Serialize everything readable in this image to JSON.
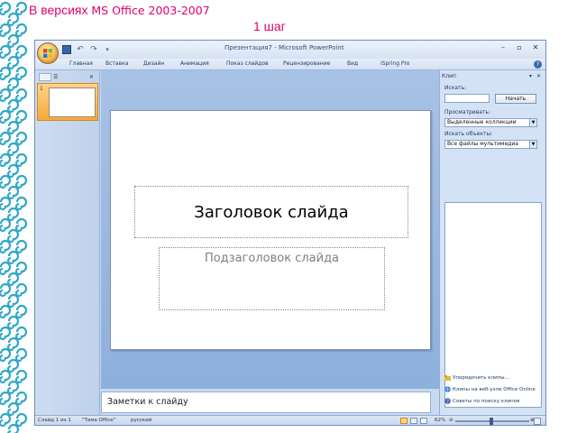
{
  "heading": {
    "prefix": "В версиях ",
    "suffix": "MS Office 2003-2007",
    "step": "1 шаг"
  },
  "colors": {
    "heading": "#e0006c",
    "ornament": "#2fa8c8",
    "ribbon": "#d4e2f4",
    "slide_selected": "#f6a93a"
  },
  "window": {
    "title": "Презентация7 - Microsoft PowerPoint",
    "controls": [
      "minimize-icon",
      "maximize-icon",
      "close-icon"
    ]
  },
  "quick_access": [
    "save-icon",
    "undo-icon",
    "redo-icon",
    "more-icon"
  ],
  "ribbon": {
    "tabs": [
      "Главная",
      "Вставка",
      "Дизайн",
      "Анимация",
      "Показ слайдов",
      "Рецензирование",
      "Вид",
      "iSpring Pro"
    ]
  },
  "slides_panel": {
    "selected_number": "1"
  },
  "slide": {
    "title": "Заголовок слайда",
    "subtitle": "Подзаголовок слайда"
  },
  "notes": {
    "placeholder": "Заметки к слайду"
  },
  "task_pane": {
    "title": "Клип",
    "search_label": "Искать:",
    "search_value": "",
    "search_button": "Начать",
    "browse_label": "Просматривать:",
    "browse_value": "Выделенные коллекции",
    "search_objects_label": "Искать объекты:",
    "objects_value": "Все файлы мультимедиа",
    "links": [
      "Упорядочить клипы...",
      "Клипы на веб-узле Office Online",
      "Советы по поиску клипов"
    ]
  },
  "status": {
    "slide": "Слайд 1 из 1",
    "theme": "\"Тема Office\"",
    "language": "русский",
    "zoom": "62%",
    "zoom_value": 62
  }
}
